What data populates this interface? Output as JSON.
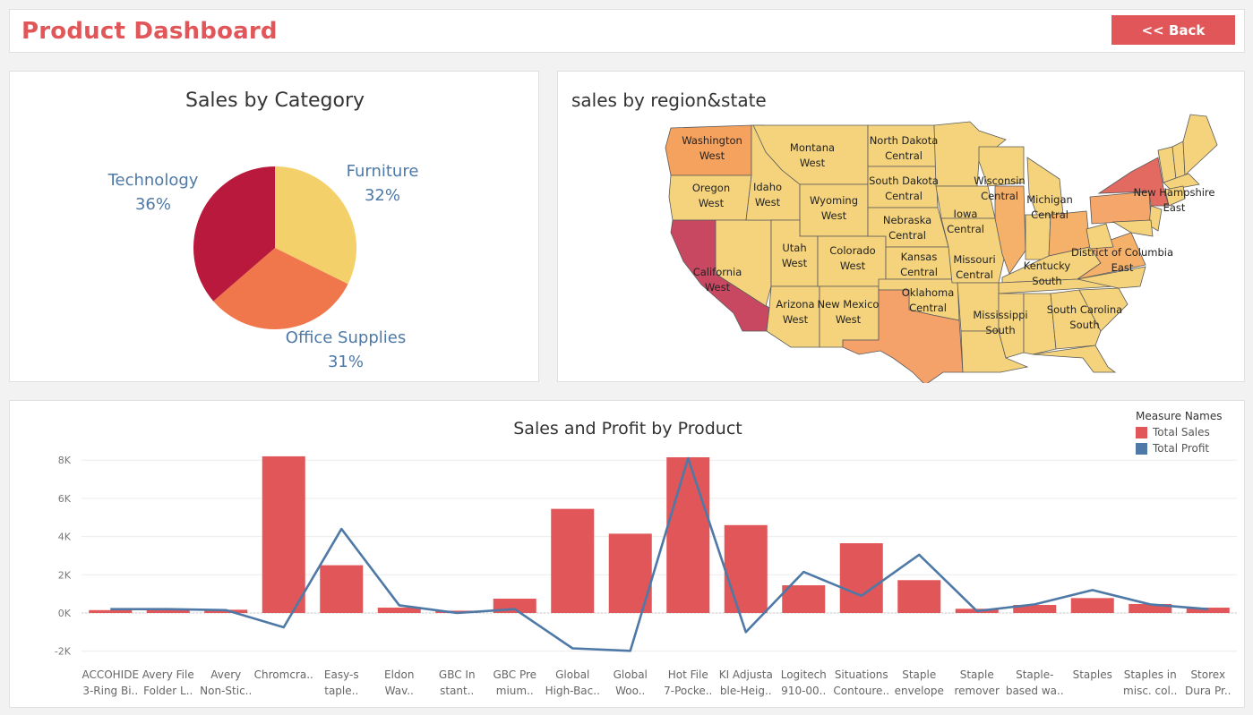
{
  "header": {
    "title": "Product Dashboard",
    "back_label": "<<  Back"
  },
  "colors": {
    "accent": "#e15759",
    "profit_line": "#4e79a7",
    "technology": "#b9193c",
    "furniture": "#f4d06a",
    "office_supplies": "#f0774c"
  },
  "pie": {
    "title": "Sales by Category",
    "slices": [
      {
        "name": "Technology",
        "pct_label": "36%",
        "value": 36,
        "color": "#b9193c"
      },
      {
        "name": "Furniture",
        "pct_label": "32%",
        "value": 32,
        "color": "#f4d06a"
      },
      {
        "name": "Office Supplies",
        "pct_label": "31%",
        "value": 31,
        "color": "#f0774c"
      }
    ]
  },
  "map": {
    "title": "sales by region&state",
    "labels": [
      {
        "state": "Washington",
        "region": "West"
      },
      {
        "state": "Montana",
        "region": "West"
      },
      {
        "state": "North Dakota",
        "region": "Central"
      },
      {
        "state": "Oregon",
        "region": "West"
      },
      {
        "state": "Idaho",
        "region": "West"
      },
      {
        "state": "South Dakota",
        "region": "Central"
      },
      {
        "state": "Wyoming",
        "region": "West"
      },
      {
        "state": "Wisconsin",
        "region": "Central"
      },
      {
        "state": "Michigan",
        "region": "Central"
      },
      {
        "state": "New Hampshire",
        "region": "East"
      },
      {
        "state": "Nebraska",
        "region": "Central"
      },
      {
        "state": "Iowa",
        "region": "Central"
      },
      {
        "state": "Utah",
        "region": "West"
      },
      {
        "state": "Colorado",
        "region": "West"
      },
      {
        "state": "Kansas",
        "region": "Central"
      },
      {
        "state": "Missouri",
        "region": "Central"
      },
      {
        "state": "District of Columbia",
        "region": "East"
      },
      {
        "state": "California",
        "region": "West"
      },
      {
        "state": "Kentucky",
        "region": "South"
      },
      {
        "state": "Oklahoma",
        "region": "Central"
      },
      {
        "state": "Arizona",
        "region": "West"
      },
      {
        "state": "New Mexico",
        "region": "West"
      },
      {
        "state": "Mississippi",
        "region": "South"
      },
      {
        "state": "South Carolina",
        "region": "South"
      }
    ]
  },
  "chart_data": {
    "type": "bar",
    "title": "Sales and Profit by Product",
    "legend_title": "Measure Names",
    "legend_position": "top-right",
    "grid": true,
    "ylim": [
      -2500,
      8500
    ],
    "yticks": [
      -2000,
      0,
      2000,
      4000,
      6000,
      8000
    ],
    "ytick_labels": [
      "-2K",
      "0K",
      "2K",
      "4K",
      "6K",
      "8K"
    ],
    "categories": [
      [
        "ACCOHIDE",
        "3-Ring Bi.."
      ],
      [
        "Avery File",
        "Folder L.."
      ],
      [
        "Avery",
        "Non-Stic.."
      ],
      [
        "Chromcra..",
        ""
      ],
      [
        "Easy-s",
        "taple.."
      ],
      [
        "Eldon",
        "Wav.."
      ],
      [
        "GBC In",
        "stant.."
      ],
      [
        "GBC Pre",
        "mium.."
      ],
      [
        "Global",
        "High-Bac.."
      ],
      [
        "Global",
        "Woo.."
      ],
      [
        "Hot File",
        "7-Pocke.."
      ],
      [
        "KI Adjusta",
        "ble-Heig.."
      ],
      [
        "Logitech",
        "910-00.."
      ],
      [
        "Situations",
        "Contoure.."
      ],
      [
        "Staple",
        "envelope"
      ],
      [
        "Staple",
        "remover"
      ],
      [
        "Staple-",
        "based wa.."
      ],
      [
        "Staples",
        ""
      ],
      [
        "Staples in",
        "misc. col.."
      ],
      [
        "Storex",
        "Dura Pr.."
      ]
    ],
    "series": [
      {
        "name": "Total Sales",
        "type": "bar",
        "color": "#e15759",
        "values": [
          150,
          150,
          170,
          8200,
          2500,
          280,
          120,
          750,
          5450,
          4150,
          8150,
          4600,
          1450,
          3650,
          1720,
          220,
          420,
          780,
          470,
          280
        ]
      },
      {
        "name": "Total Profit",
        "type": "line",
        "color": "#4e79a7",
        "values": [
          200,
          200,
          150,
          -750,
          4400,
          400,
          0,
          200,
          -1850,
          -1980,
          8100,
          -1000,
          2150,
          900,
          3050,
          100,
          450,
          1200,
          450,
          200
        ]
      }
    ]
  }
}
